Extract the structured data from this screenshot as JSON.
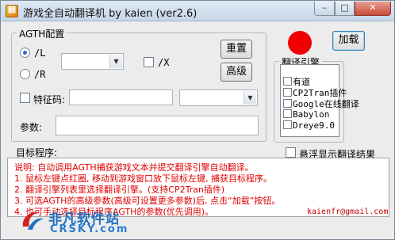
{
  "window": {
    "title": "游戏全自动翻译机  by kaien (ver2.6)",
    "icon_text": "翻",
    "controls": {
      "minimize": "–",
      "maximize": "□",
      "close": "✕"
    }
  },
  "agth": {
    "group_label": "AGTH配置",
    "radio_l": "/L",
    "radio_r": "/R",
    "check_x": "/X",
    "feature_code": "特征码:",
    "params": "参数:",
    "radio_l_checked": true
  },
  "buttons": {
    "reset": "重置",
    "advanced": "高级",
    "load": "加载"
  },
  "engines": {
    "group_label": "翻译引擎",
    "items": [
      "有道",
      "CP2Tran插件",
      "Google在线翻译",
      "Babylon",
      "Dreye9.0"
    ]
  },
  "target": {
    "label": "目标程序:",
    "float_label": "悬浮显示翻译结果"
  },
  "info": {
    "lines": [
      "说明: 自动调用AGTH捕获游戏文本并提交翻译引擎自动翻译。",
      "1. 鼠标左键点红圈, 移动到游戏窗口放下鼠标左键, 捕获目标程序。",
      "2. 翻译引擎列表里选择翻译引擎。(支持CP2Tran插件)",
      "3. 可选AGTH的高级参数(高级可设置更多参数)后, 点击“加载”按钮。",
      "4. 也可手动选择目标程序AGTH的参数(优先调用)。"
    ],
    "email": "kaienfr@gmail.com"
  },
  "watermark": {
    "cn": "非凡软件站",
    "en": "CRSKY.com"
  },
  "colors": {
    "indicator": "#f00000",
    "info_text": "#e00000",
    "watermark": "#1f6fc1"
  }
}
